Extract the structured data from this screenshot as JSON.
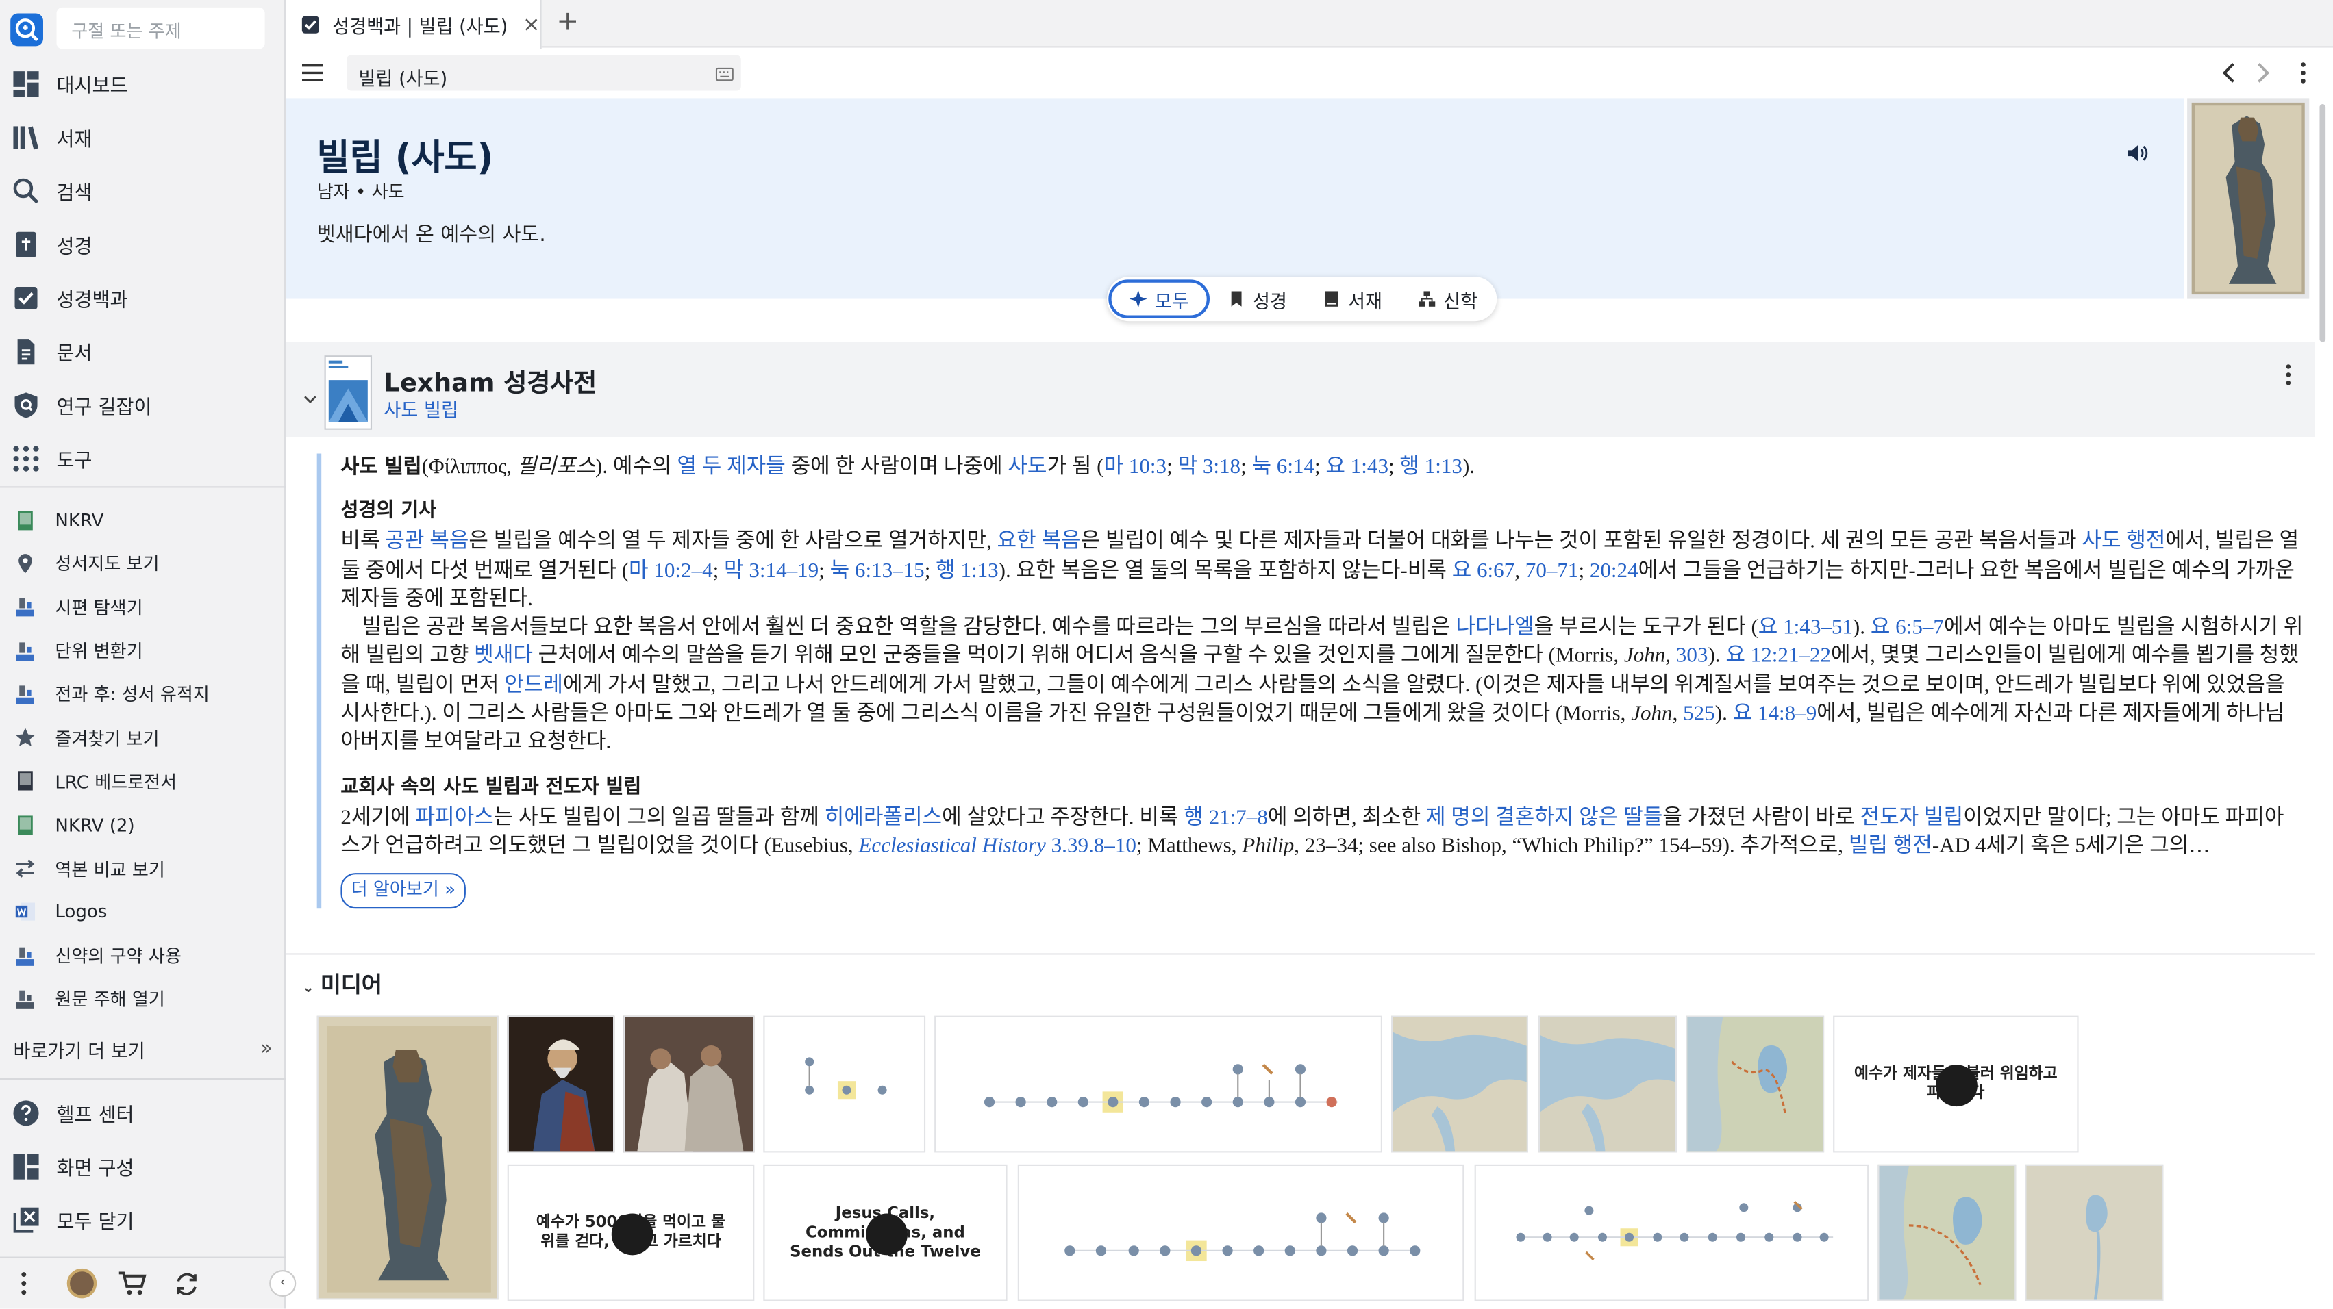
{
  "sidebar": {
    "search_placeholder": "구절 또는 주제",
    "main": [
      {
        "label": "대시보드",
        "icon": "dashboard-icon"
      },
      {
        "label": "서재",
        "icon": "library-icon"
      },
      {
        "label": "검색",
        "icon": "search-icon"
      },
      {
        "label": "성경",
        "icon": "bible-icon"
      },
      {
        "label": "성경백과",
        "icon": "factbook-icon"
      },
      {
        "label": "문서",
        "icon": "document-icon"
      },
      {
        "label": "연구 길잡이",
        "icon": "guide-icon"
      },
      {
        "label": "도구",
        "icon": "tools-icon"
      }
    ],
    "shortcuts": [
      {
        "label": "NKRV",
        "icon": "book-icon",
        "color": "#3b8a5a"
      },
      {
        "label": "성서지도 보기",
        "icon": "map-pin-icon",
        "color": "#4a5563"
      },
      {
        "label": "시편 탐색기",
        "icon": "tool-icon",
        "color": "#3a6fc4"
      },
      {
        "label": "단위 변환기",
        "icon": "tool-icon",
        "color": "#3a6fc4"
      },
      {
        "label": "전과 후: 성서 유적지",
        "icon": "tool-icon",
        "color": "#3a6fc4"
      },
      {
        "label": "즐겨찾기 보기",
        "icon": "star-icon",
        "color": "#4a5563"
      },
      {
        "label": "LRC 베드로전서",
        "icon": "book-icon",
        "color": "#2e3440"
      },
      {
        "label": "NKRV (2)",
        "icon": "book-icon",
        "color": "#3b8a5a"
      },
      {
        "label": "역본 비교 보기",
        "icon": "compare-icon",
        "color": "#4a5563"
      },
      {
        "label": "Logos",
        "icon": "word-icon",
        "color": "#2b5fb8"
      },
      {
        "label": "신약의 구약 사용",
        "icon": "tool-icon",
        "color": "#3a6fc4"
      },
      {
        "label": "원문 주해 열기",
        "icon": "tool-icon",
        "color": "#4a5563"
      }
    ],
    "more_label": "바로가기 더 보기",
    "bottom": [
      {
        "label": "헬프 센터",
        "icon": "help-icon"
      },
      {
        "label": "화면 구성",
        "icon": "layout-icon"
      },
      {
        "label": "모두 닫기",
        "icon": "close-all-icon"
      }
    ]
  },
  "tab": {
    "title": "성경백과 | 빌립 (사도)",
    "close": "×",
    "add": "+"
  },
  "address": {
    "value": "빌립 (사도)"
  },
  "header": {
    "title": "빌립 (사도)",
    "meta": "남자 • 사도",
    "summary": "벳새다에서 온 예수의 사도."
  },
  "filters": [
    {
      "label": "모두",
      "icon": "sparkle-icon",
      "active": true
    },
    {
      "label": "성경",
      "icon": "bookmark-icon"
    },
    {
      "label": "서재",
      "icon": "book-icon"
    },
    {
      "label": "신학",
      "icon": "theology-icon"
    }
  ],
  "lexham": {
    "title": "Lexham 성경사전",
    "subtitle": "사도 빌립",
    "readmore": "더 알아보기 »"
  },
  "media": {
    "heading": "미디어",
    "cards": [
      {
        "text": "예수가 제자들을 불러 위임하고 파송하다"
      },
      {
        "text": "예수가 5000명을 먹이고 물 위를 걷다, 그리고 가르치다"
      },
      {
        "text": "Jesus Calls, Commissions, and Sends Out the Twelve"
      }
    ]
  }
}
